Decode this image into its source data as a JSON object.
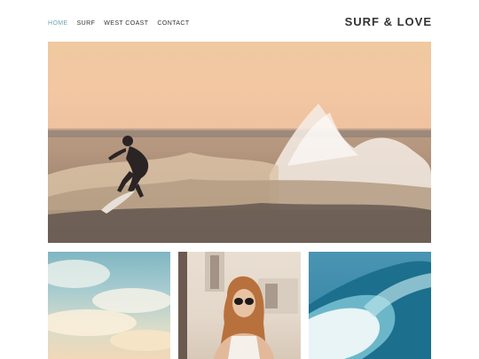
{
  "nav": {
    "items": [
      {
        "label": "HOME",
        "active": true
      },
      {
        "label": "SURF",
        "active": false
      },
      {
        "label": "WEST COAST",
        "active": false
      },
      {
        "label": "CONTACT",
        "active": false
      }
    ],
    "active_color": "#6ea3b3"
  },
  "brand": {
    "title": "SURF & LOVE"
  },
  "gallery": {
    "hero": {
      "subject": "surfer riding wave at sunset"
    },
    "thumbs": [
      {
        "subject": "sky with clouds"
      },
      {
        "subject": "woman wearing sunglasses"
      },
      {
        "subject": "breaking wave"
      }
    ]
  }
}
